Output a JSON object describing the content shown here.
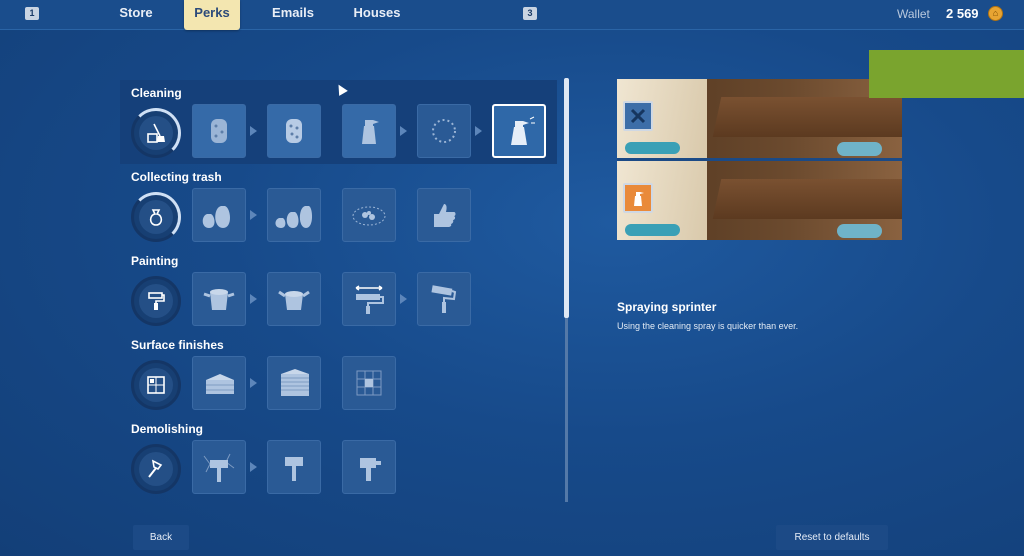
{
  "topbar": {
    "key_left": "1",
    "key_right": "3",
    "tabs": [
      {
        "label": "Store",
        "active": false
      },
      {
        "label": "Perks",
        "active": true
      },
      {
        "label": "Emails",
        "active": false
      },
      {
        "label": "Houses",
        "active": false
      }
    ],
    "wallet_label": "Wallet",
    "wallet_value": "2 569"
  },
  "categories": [
    {
      "title": "Cleaning",
      "icon": "broom-bucket-icon",
      "selected": true,
      "perks": [
        "sponge-icon",
        "sponge-upgraded-icon",
        "spray-bottle-icon",
        "sparkle-circle-icon",
        "spray-sprinter-icon"
      ]
    },
    {
      "title": "Collecting trash",
      "icon": "trash-bag-icon",
      "selected": false,
      "perks": [
        "trash-bags-icon",
        "trash-bags-more-icon",
        "trash-pile-icon",
        "thumbs-up-icon"
      ]
    },
    {
      "title": "Painting",
      "icon": "paint-roller-icon",
      "selected": false,
      "perks": [
        "paint-bucket-icon",
        "paint-bucket-upgraded-icon",
        "roller-wide-icon",
        "roller-icon"
      ]
    },
    {
      "title": "Surface finishes",
      "icon": "tiles-icon",
      "selected": false,
      "perks": [
        "stack-tiles-icon",
        "stack-panels-icon",
        "tile-grid-icon"
      ]
    },
    {
      "title": "Demolishing",
      "icon": "hammer-icon",
      "selected": false,
      "perks": [
        "sledgehammer-icon",
        "hammer-upgraded-icon",
        "power-hammer-icon"
      ]
    }
  ],
  "preview": {
    "top_icon": "locked-x-icon",
    "bottom_icon": "spray-sprinter-icon"
  },
  "selected_perk": {
    "name": "Spraying sprinter",
    "description": "Using the cleaning spray is quicker than ever."
  },
  "buttons": {
    "back": "Back",
    "reset": "Reset to defaults"
  },
  "colors": {
    "background": "#174a8a",
    "active_tab": "#f3e6b0",
    "accent_green": "#7aa42e",
    "coin": "#e8a432"
  }
}
